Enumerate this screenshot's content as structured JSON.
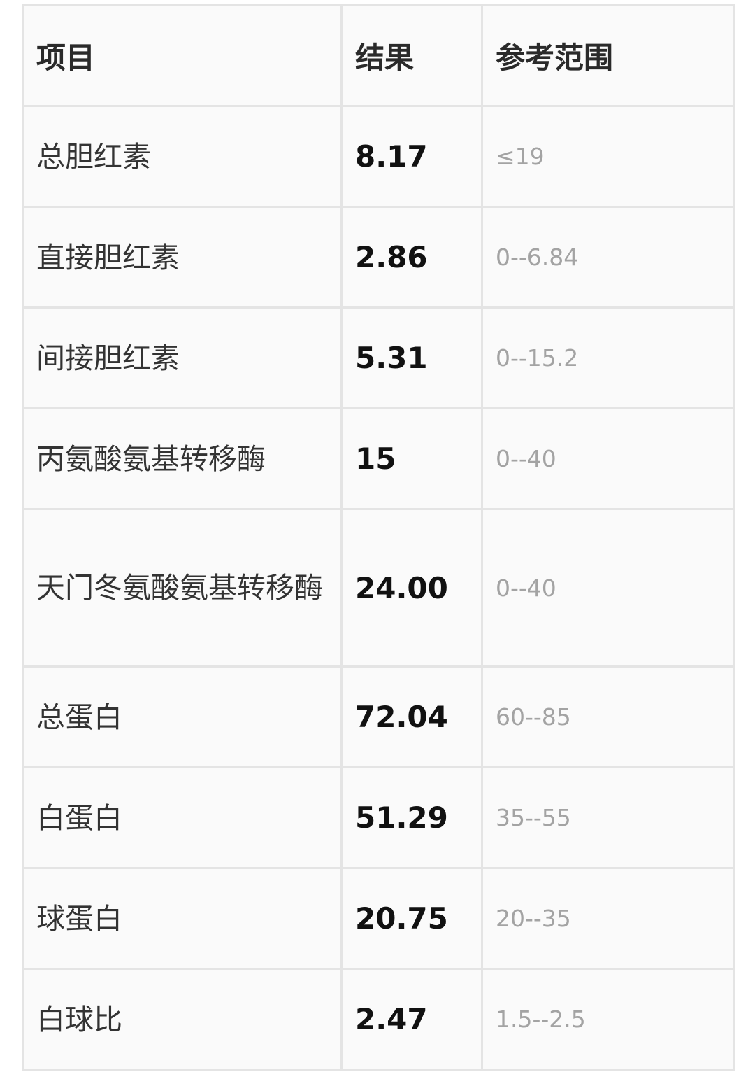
{
  "table": {
    "headers": [
      "项目",
      "结果",
      "参考范围"
    ],
    "rows": [
      {
        "item": "总胆红素",
        "result": "8.17",
        "reference": "≤19"
      },
      {
        "item": "直接胆红素",
        "result": "2.86",
        "reference": "0--6.84"
      },
      {
        "item": "间接胆红素",
        "result": "5.31",
        "reference": "0--15.2"
      },
      {
        "item": "丙氨酸氨基转移酶",
        "result": "15",
        "reference": "0--40"
      },
      {
        "item": "天门冬氨酸氨基转移酶",
        "result": "24.00",
        "reference": "0--40"
      },
      {
        "item": "总蛋白",
        "result": "72.04",
        "reference": "60--85"
      },
      {
        "item": "白蛋白",
        "result": "51.29",
        "reference": "35--55"
      },
      {
        "item": "球蛋白",
        "result": "20.75",
        "reference": "20--35"
      },
      {
        "item": "白球比",
        "result": "2.47",
        "reference": "1.5--2.5"
      }
    ]
  }
}
